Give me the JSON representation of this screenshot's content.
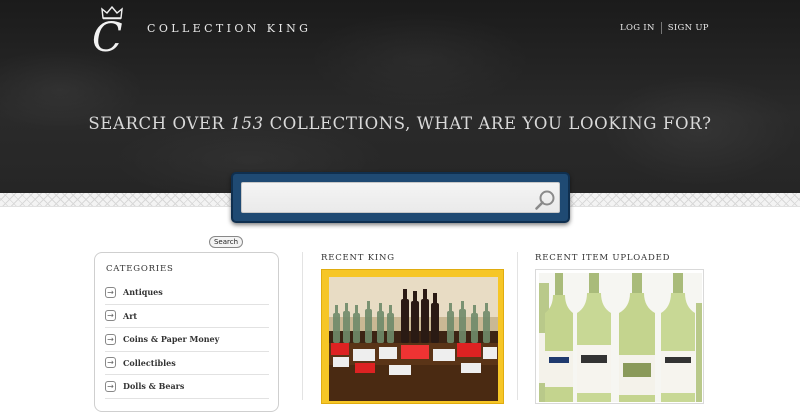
{
  "header": {
    "brand_name": "COLLECTION KING",
    "logo_letter": "C",
    "login_label": "LOG IN",
    "signup_label": "SIGN UP"
  },
  "hero": {
    "headline_before": "SEARCH OVER ",
    "collection_count": "153",
    "headline_after": " COLLECTIONS, WHAT ARE YOU LOOKING FOR?"
  },
  "search": {
    "value": "",
    "placeholder": "",
    "button_label": "Search"
  },
  "categories": {
    "title": "CATEGORIES",
    "items": [
      {
        "label": "Antiques"
      },
      {
        "label": "Art"
      },
      {
        "label": "Coins & Paper Money"
      },
      {
        "label": "Collectibles"
      },
      {
        "label": "Dolls & Bears"
      }
    ]
  },
  "recent_king": {
    "title": "RECENT KING"
  },
  "recent_item": {
    "title": "RECENT ITEM UPLOADED"
  },
  "colors": {
    "search_frame": "#1f4a73",
    "king_frame": "#f6c626",
    "hero_bg": "#222222"
  }
}
